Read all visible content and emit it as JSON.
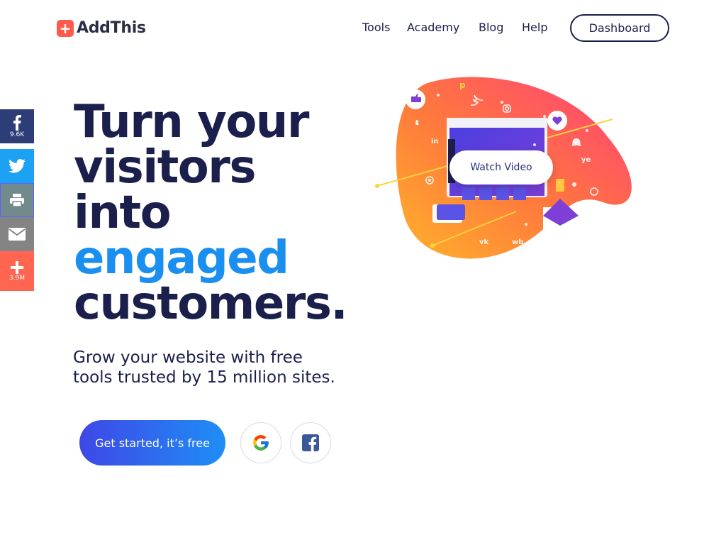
{
  "brand": {
    "name": "AddThis",
    "logo_mark": "+"
  },
  "nav": {
    "items": [
      {
        "label": "Tools"
      },
      {
        "label": "Academy"
      },
      {
        "label": "Blog"
      },
      {
        "label": "Help"
      }
    ],
    "dashboard_label": "Dashboard"
  },
  "share_bar": {
    "facebook": {
      "icon": "facebook-icon",
      "count": "9.6K",
      "color": "#2d3d77"
    },
    "twitter": {
      "icon": "twitter-icon",
      "color": "#1da1f2"
    },
    "print": {
      "icon": "printer-icon",
      "color": "#738a8d"
    },
    "email": {
      "icon": "email-icon",
      "color": "#848484"
    },
    "more": {
      "icon": "plus-icon",
      "count": "3.9M",
      "color": "#ff6550"
    }
  },
  "hero": {
    "line1": "Turn your",
    "line2": "visitors",
    "line3": "into",
    "line4": "engaged",
    "line5": "customers.",
    "sub1": "Grow your website with free",
    "sub2": "tools trusted by 15 million sites.",
    "cta_label": "Get started, it’s free",
    "google_icon": "google-icon",
    "facebook_icon": "facebook-icon"
  },
  "illustration": {
    "watch_video_label": "Watch Video",
    "colors": {
      "blob_start": "#ff3e7a",
      "blob_end": "#ffb22b"
    }
  },
  "colors": {
    "navy": "#1b1f4b",
    "accent_blue": "#1b8ff0",
    "brand_red": "#ff5a4b"
  }
}
